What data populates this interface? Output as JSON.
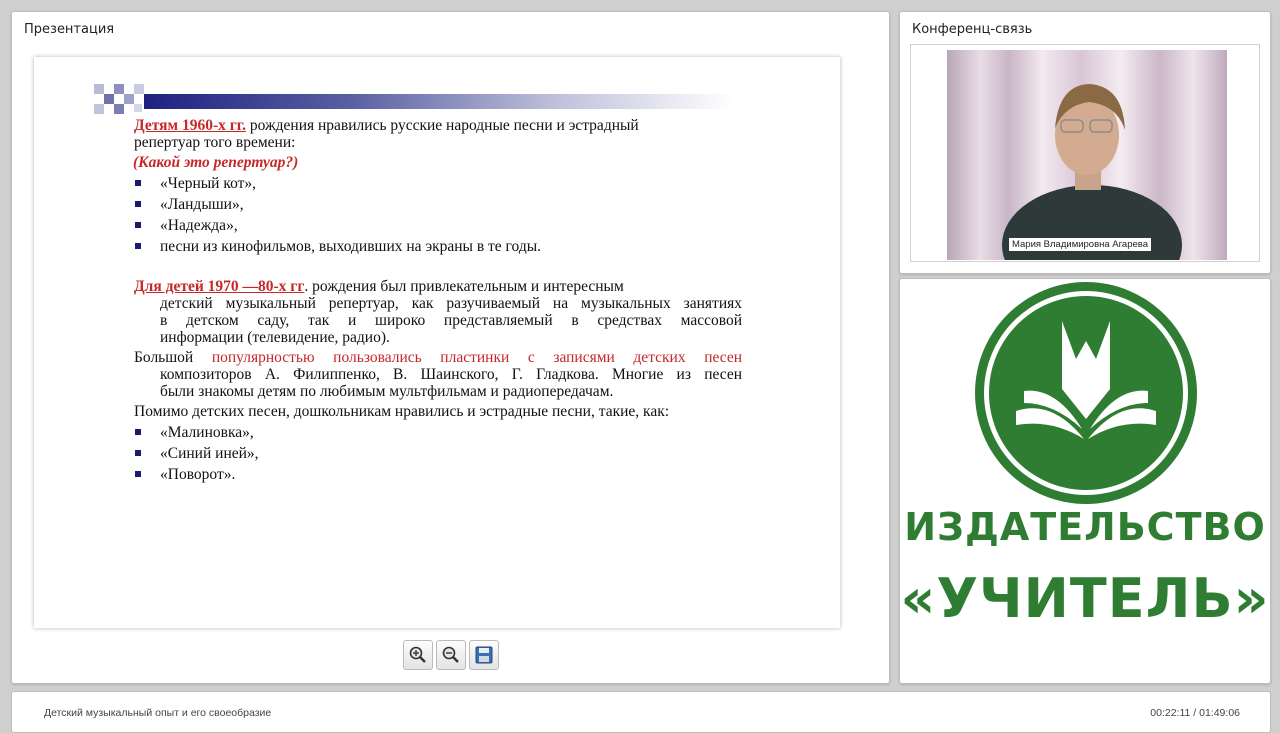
{
  "presentation": {
    "title": "Презентация",
    "slide": {
      "p1_head": "Детям 1960-х гг.",
      "p1_rest": " рождения нравились русские народные песни и эстрадный",
      "p1_line2": "репертуар того времени:",
      "question": "(Какой это репертуар?)",
      "list1": [
        "«Черный кот»,",
        "«Ландыши»,",
        "«Надежда»,",
        "песни из кинофильмов, выходивших на экраны в те годы."
      ],
      "p2_head": "Для детей 1970 —80-х гг",
      "p2_rest": ". рождения был привлекательным и интересным",
      "p2_line2": "детский музыкальный репертуар, как разучиваемый на музыкальных занятиях",
      "p2_line3": "в детском саду, так и широко представляемый в средствах массовой",
      "p2_line4": "информации (телевидение, радио).",
      "p3_word": "Большой ",
      "p3_red": "популярностью пользовались пластинки с записями детских песен",
      "p3_line2": "композиторов А. Филиппенко, В. Шаинского, Г. Гладкова. Многие из песен",
      "p3_line3": "были знакомы детям по любимым мультфильмам и радиопередачам.",
      "p4": "Помимо детских песен, дошкольникам нравились и эстрадные песни, такие, как:",
      "list2": [
        "«Малиновка»,",
        "«Синий иней»,",
        "«Поворот»."
      ]
    },
    "toolbar": {
      "zoom_in_icon": "zoom-in-magnifier-plus",
      "zoom_out_icon": "zoom-out-magnifier-minus",
      "save_icon": "floppy-disk"
    }
  },
  "conference": {
    "title": "Конференц-связь",
    "speaker_name": "Мария Владимировна Агарева"
  },
  "publisher": {
    "line1": "ИЗДАТЕЛЬСТВО",
    "line2": "«УЧИТЕЛЬ»",
    "brand_color": "#2e7d32"
  },
  "footer": {
    "webinar_title": "Детский музыкальный опыт и его своеобразие",
    "time": "00:22:11 / 01:49:06"
  }
}
